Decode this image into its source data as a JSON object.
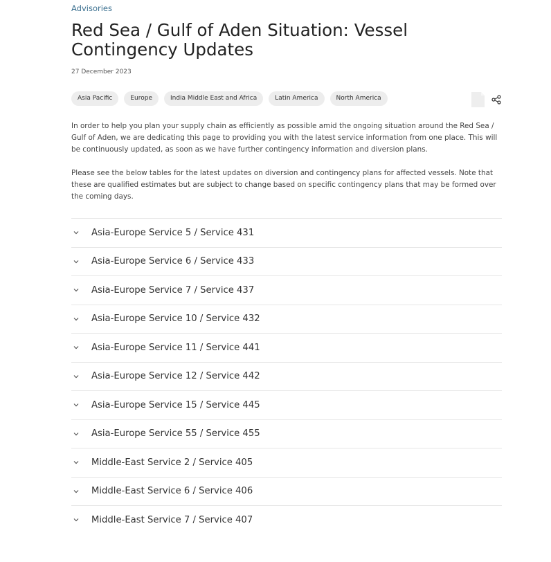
{
  "breadcrumb": "Advisories",
  "title": "Red Sea / Gulf of Aden Situation: Vessel Contingency Updates",
  "date": "27 December 2023",
  "tags": [
    "Asia Pacific",
    "Europe",
    "India Middle East and Africa",
    "Latin America",
    "North America"
  ],
  "icons": {
    "document": "document-icon",
    "share": "share-icon",
    "chevron": "chevron-down-icon"
  },
  "intro": {
    "p1": "In order to help you plan your supply chain as efficiently as possible amid the ongoing situation around the Red Sea / Gulf of Aden, we are dedicating this page to providing you with the latest service information from one place. This will be continuously updated, as soon as we have further contingency information and diversion plans.",
    "p2": "Please see the below tables for the latest updates on diversion and contingency plans for affected vessels. Note that these are qualified estimates but are subject to change based on specific contingency plans that may be formed over the coming days."
  },
  "services": [
    "Asia-Europe Service 5 / Service 431",
    "Asia-Europe Service 6 / Service 433",
    "Asia-Europe Service 7 / Service 437",
    "Asia-Europe Service 10 / Service 432",
    "Asia-Europe Service 11 / Service 441",
    "Asia-Europe Service 12 / Service 442",
    "Asia-Europe Service 15 / Service 445",
    "Asia-Europe Service 55 / Service 455",
    "Middle-East Service 2 / Service 405",
    "Middle-East Service 6 / Service 406",
    "Middle-East Service 7 / Service 407"
  ]
}
